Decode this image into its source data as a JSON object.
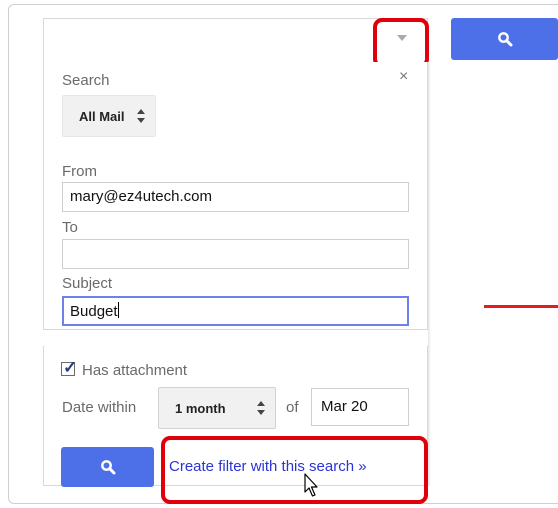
{
  "search_panel": {
    "search_label": "Search",
    "scope_value": "All Mail",
    "from_label": "From",
    "from_value": "mary@ez4utech.com",
    "to_label": "To",
    "to_value": "",
    "subject_label": "Subject",
    "subject_value": "Budget",
    "close_glyph": "×",
    "has_attachment_label": "Has attachment",
    "has_attachment_checked": true,
    "date_within_label": "Date within",
    "date_within_value": "1 month",
    "of_label": "of",
    "date_value": "Mar 20",
    "create_filter_link": "Create filter with this search »"
  },
  "icons": {
    "search": "search-icon",
    "dropdown": "chevron-down-icon",
    "close": "close-icon",
    "cursor": "mouse-pointer-icon"
  },
  "colors": {
    "button_blue": "#4d6fe8",
    "highlight_red": "#e0000a",
    "link_blue": "#2a34d6",
    "focus_border": "#6d82e9"
  }
}
